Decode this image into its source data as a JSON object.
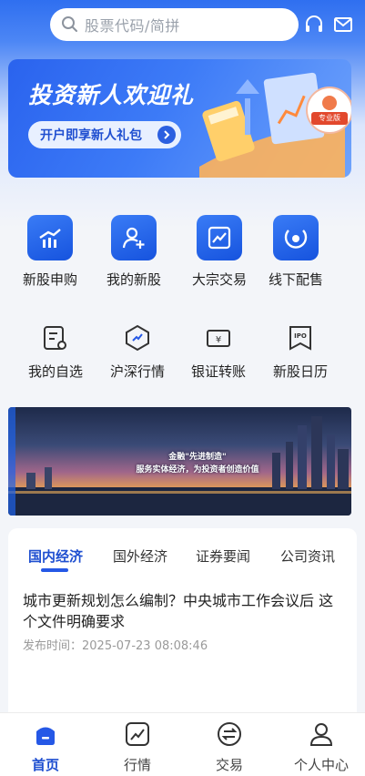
{
  "search": {
    "placeholder": "股票代码/简拼"
  },
  "header_icons": [
    "headset-icon",
    "mail-icon"
  ],
  "banner": {
    "title": "投资新人欢迎礼",
    "button_label": "开户即享新人礼包",
    "badge": "专业版"
  },
  "quick_actions": [
    {
      "label": "新股申购",
      "icon": "ipo-chart-icon"
    },
    {
      "label": "我的新股",
      "icon": "user-add-icon"
    },
    {
      "label": "大宗交易",
      "icon": "trend-icon"
    },
    {
      "label": "线下配售",
      "icon": "circle-dot-icon"
    }
  ],
  "secondary_actions": [
    {
      "label": "我的自选",
      "icon": "watchlist-icon"
    },
    {
      "label": "沪深行情",
      "icon": "market-icon"
    },
    {
      "label": "银证转账",
      "icon": "transfer-icon"
    },
    {
      "label": "新股日历",
      "icon": "ipo-calendar-icon"
    }
  ],
  "secondary_icon_text": {
    "transfer": "¥",
    "ipo": "IPO"
  },
  "city_banner": {
    "line1": "金融\"先进制造\"",
    "line2": "服务实体经济，为投资者创造价值"
  },
  "news": {
    "tabs": [
      "国内经济",
      "国外经济",
      "证券要闻",
      "公司资讯"
    ],
    "active_tab": 0,
    "article": {
      "title": "城市更新规划怎么编制？中央城市工作会议后 这个文件明确要求",
      "meta_label": "发布时间：",
      "meta_time": "2025-07-23 08:08:46"
    }
  },
  "bottom_nav": [
    {
      "label": "首页",
      "icon": "home-icon",
      "active": true
    },
    {
      "label": "行情",
      "icon": "chart-icon",
      "active": false
    },
    {
      "label": "交易",
      "icon": "exchange-icon",
      "active": false
    },
    {
      "label": "个人中心",
      "icon": "profile-icon",
      "active": false
    }
  ],
  "colors": {
    "primary": "#2558e6",
    "header_top": "#2f6ff0",
    "background": "#f3f5f9"
  }
}
